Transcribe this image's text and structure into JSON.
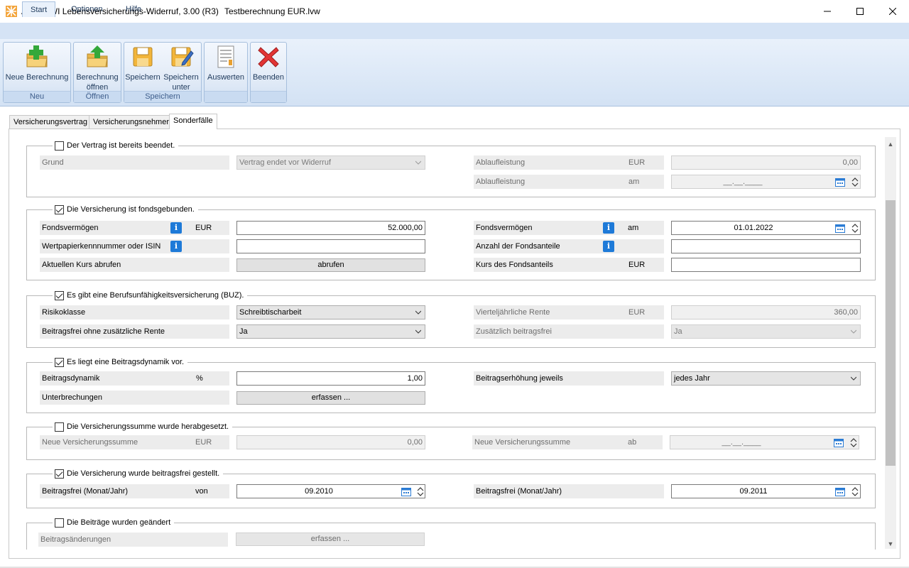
{
  "window": {
    "title": "ALF-LVWI Lebensversicherungs-Widerruf, 3.00 (R3)",
    "file": "Testberechnung EUR.lvw"
  },
  "ribbon": {
    "tabs": [
      "Start",
      "Optionen",
      "Hilfe"
    ],
    "active_tab": "Start",
    "groups": {
      "neu": "Neu",
      "oeffnen": "Öffnen",
      "speichern": "Speichern"
    },
    "buttons": {
      "neue_berechnung": "Neue Berechnung",
      "berechnung_1": "Berechnung",
      "berechnung_2": "öffnen",
      "speichern": "Speichern",
      "speichern_unter_1": "Speichern",
      "speichern_unter_2": "unter",
      "auswerten": "Auswerten",
      "beenden": "Beenden"
    }
  },
  "content_tabs": [
    "Versicherungsvertrag",
    "Versicherungsnehmer",
    "Sonderfälle"
  ],
  "active_content_tab": "Sonderfälle",
  "sections": {
    "beendet": {
      "checkbox_label": "Der Vertrag ist bereits beendet.",
      "checked": false,
      "grund_label": "Grund",
      "grund_value": "Vertrag endet vor Widerruf",
      "ablauf_label": "Ablaufleistung",
      "ablauf_unit": "EUR",
      "ablauf_value": "0,00",
      "ablauf_am_label": "Ablaufleistung",
      "ablauf_am_unit": "am",
      "ablauf_am_value": "__.__.____"
    },
    "fonds": {
      "checkbox_label": "Die Versicherung ist fondsgebunden.",
      "checked": true,
      "vermoegen_label": "Fondsvermögen",
      "vermoegen_unit": "EUR",
      "vermoegen_value": "52.000,00",
      "vermoegen_am_label": "Fondsvermögen",
      "vermoegen_am_unit": "am",
      "vermoegen_am_value": "01.01.2022",
      "wkn_label": "Wertpapierkennnummer oder ISIN",
      "wkn_value": "",
      "anteile_label": "Anzahl der Fondsanteile",
      "anteile_value": "",
      "kurs_abrufen_label": "Aktuellen Kurs abrufen",
      "kurs_abrufen_button": "abrufen",
      "kurs_label": "Kurs des Fondsanteils",
      "kurs_unit": "EUR",
      "kurs_value": ""
    },
    "buz": {
      "checkbox_label": "Es gibt eine Berufsunfähigkeitsversicherung (BUZ).",
      "checked": true,
      "risiko_label": "Risikoklasse",
      "risiko_value": "Schreibtischarbeit",
      "rente_label": "Vierteljährliche Rente",
      "rente_unit": "EUR",
      "rente_value": "360,00",
      "beitragsfrei_label": "Beitragsfrei ohne zusätzliche Rente",
      "beitragsfrei_value": "Ja",
      "zusaetzlich_label": "Zusätzlich beitragsfrei",
      "zusaetzlich_value": "Ja"
    },
    "dynamik": {
      "checkbox_label": "Es liegt eine Beitragsdynamik vor.",
      "checked": true,
      "dynamik_label": "Beitragsdynamik",
      "dynamik_unit": "%",
      "dynamik_value": "1,00",
      "erhoehung_label": "Beitragserhöhung jeweils",
      "erhoehung_value": "jedes Jahr",
      "unterbrechungen_label": "Unterbrechungen",
      "unterbrechungen_button": "erfassen ..."
    },
    "herabgesetzt": {
      "checkbox_label": "Die Versicherungssumme wurde herabgesetzt.",
      "checked": false,
      "summe_label": "Neue Versicherungssumme",
      "summe_unit": "EUR",
      "summe_value": "0,00",
      "summe_ab_label": "Neue Versicherungssumme",
      "summe_ab_unit": "ab",
      "summe_ab_value": "__.__.____"
    },
    "beitragsfrei": {
      "checkbox_label": "Die Versicherung wurde beitragsfrei gestellt.",
      "checked": true,
      "von_label": "Beitragsfrei (Monat/Jahr)",
      "von_unit": "von",
      "von_value": "09.2010",
      "bis_label": "Beitragsfrei (Monat/Jahr)",
      "bis_value": "09.2011"
    },
    "geaendert": {
      "checkbox_label": "Die Beiträge wurden geändert",
      "checked": false,
      "aenderungen_label": "Beitragsänderungen",
      "aenderungen_button": "erfassen ..."
    }
  }
}
